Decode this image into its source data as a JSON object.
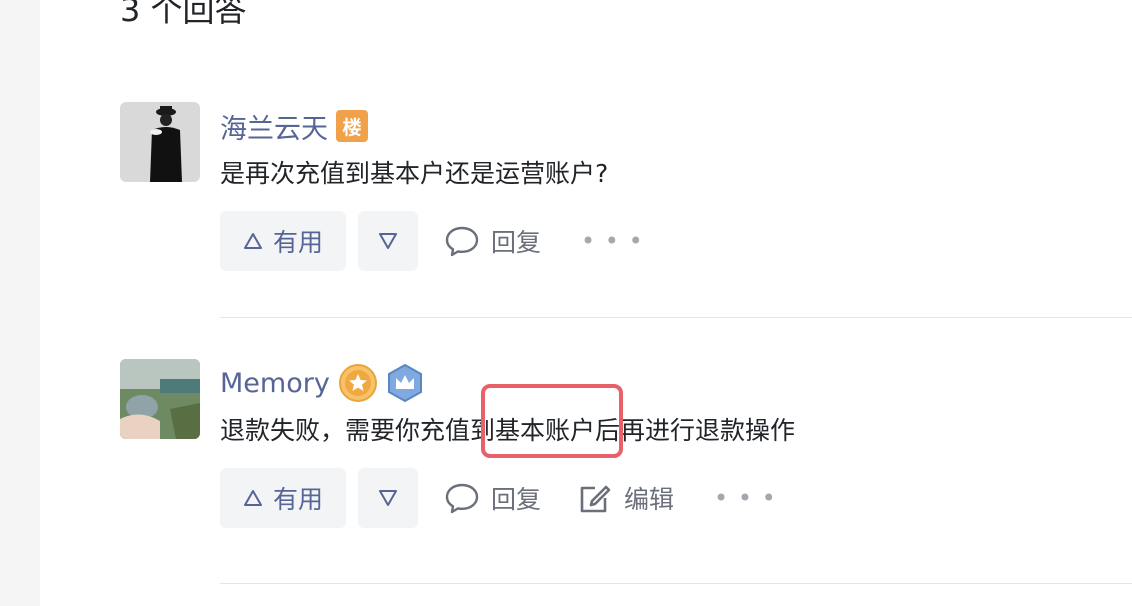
{
  "answers_title": "3 个回答",
  "answers": [
    {
      "author": "海兰云天",
      "floor_badge": "楼",
      "text": "是再次充值到基本户还是运营账户?",
      "actions": {
        "useful": "有用",
        "reply": "回复"
      }
    },
    {
      "author": "Memory",
      "text_before": "退款失败，需要你充值到",
      "text_highlight": "基本账户",
      "text_after": "后再进行退款操作",
      "actions": {
        "useful": "有用",
        "reply": "回复",
        "edit": "编辑"
      }
    }
  ],
  "colors": {
    "author": "#576596",
    "highlight_box": "#e7606a",
    "floor_badge": "#f0a149"
  }
}
